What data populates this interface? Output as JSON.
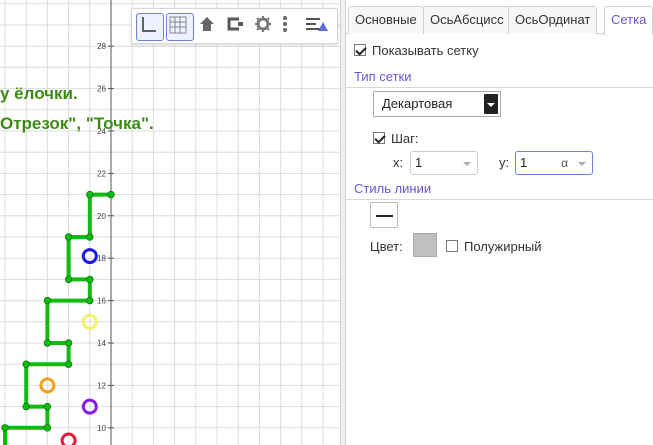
{
  "graphics": {
    "task_line1": "у ёлочки.",
    "task_line2": "Отрезок\", \"Точка\".",
    "y_ticks": [
      "28",
      "26",
      "24",
      "22",
      "20",
      "18",
      "16",
      "14",
      "12",
      "10"
    ],
    "toolbar": {
      "buttons": [
        "axes-icon",
        "grid-icon",
        "home-icon",
        "zoom-style-icon",
        "gear-icon",
        "more-icon",
        "style-bar-icon"
      ]
    },
    "colors": {
      "tree": "#11bb11",
      "text": "#3d8b15",
      "circle_blue": "#1a1ae6",
      "circle_yellow": "#f2f26b",
      "circle_orange": "#f0a020",
      "circle_purple": "#8a1ae6",
      "circle_red": "#e61a3a"
    }
  },
  "panel": {
    "tabs": [
      {
        "label": "Основные",
        "active": false
      },
      {
        "label": "ОсьАбсцисс",
        "active": false
      },
      {
        "label": "ОсьОрдинат",
        "active": false
      },
      {
        "label": "Сетка",
        "active": true
      }
    ],
    "show_grid_label": "Показывать сетку",
    "show_grid_checked": true,
    "grid_type_title": "Тип сетки",
    "grid_type_value": "Декартовая",
    "step_label": "Шаг:",
    "step_checked": true,
    "x_label": "x:",
    "x_value": "1",
    "y_label": "y:",
    "y_value": "1",
    "y_alpha": "α",
    "line_style_title": "Стиль линии",
    "color_label": "Цвет:",
    "bold_label": "Полужирный",
    "bold_checked": false,
    "accent_color": "#6557d2"
  }
}
